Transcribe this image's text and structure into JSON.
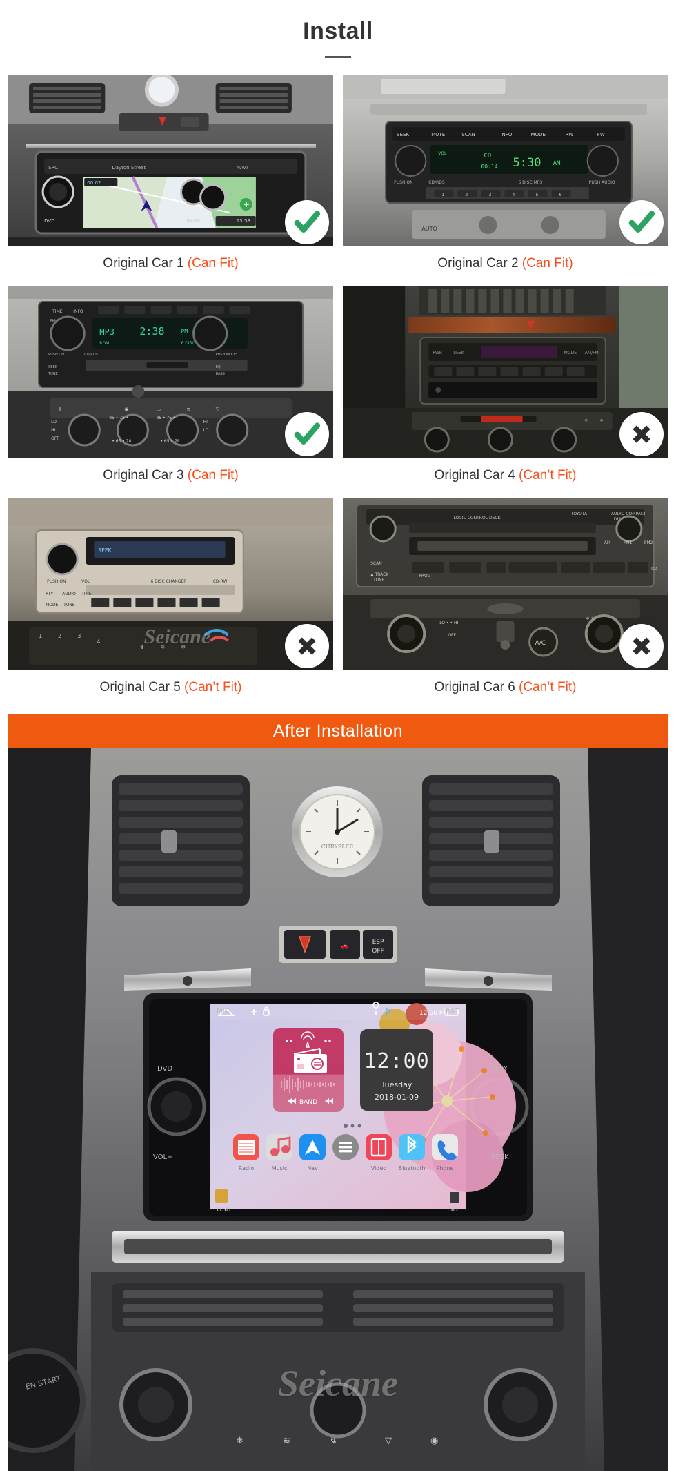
{
  "header": {
    "title": "Install"
  },
  "compat": {
    "cards": [
      {
        "label": "Original Car 1",
        "fit_text": "(Can Fit)",
        "status": "fit",
        "badge": "check-icon"
      },
      {
        "label": "Original Car 2",
        "fit_text": "(Can Fit)",
        "status": "fit",
        "badge": "check-icon"
      },
      {
        "label": "Original Car 3",
        "fit_text": "(Can Fit)",
        "status": "fit",
        "badge": "check-icon"
      },
      {
        "label": "Original Car 4",
        "fit_text": "(Can’t Fit)",
        "status": "nofit",
        "badge": "cross-icon"
      },
      {
        "label": "Original Car 5",
        "fit_text": "(Can’t Fit)",
        "status": "nofit",
        "badge": "cross-icon"
      },
      {
        "label": "Original Car 6",
        "fit_text": "(Can’t Fit)",
        "status": "nofit",
        "badge": "cross-icon"
      }
    ]
  },
  "after": {
    "banner_title": "After  Installation",
    "watermark_small": "Seicane",
    "watermark_big": "Seicane",
    "headunit": {
      "status_bar": {
        "time": "12:00 PM",
        "icons": [
          "home-icon",
          "usb-icon",
          "lock-icon",
          "location-icon",
          "bluetooth-icon",
          "wifi-icon",
          "signal-icon",
          "battery-icon"
        ]
      },
      "radio_widget": {
        "band_label": "BAND",
        "prev_icon": "rewind-icon",
        "next_icon": "fast-forward-icon",
        "radio_icon": "radio-icon"
      },
      "clock_widget": {
        "time": "12:00",
        "weekday": "Tuesday",
        "date": "2018-01-09"
      },
      "dock": [
        {
          "label": "Radio",
          "icon": "radio-app-icon",
          "color": "#F0544A"
        },
        {
          "label": "Music",
          "icon": "music-app-icon",
          "color": "#D9D9D9"
        },
        {
          "label": "Nav",
          "icon": "navigation-app-icon",
          "color": "#1E90F0"
        },
        {
          "label": "Apps",
          "icon": "app-drawer-icon",
          "color": "#8A8A8A"
        },
        {
          "label": "Video",
          "icon": "video-app-icon",
          "color": "#F0465A"
        },
        {
          "label": "Bluetooth",
          "icon": "bluetooth-app-icon",
          "color": "#4FC3F7"
        },
        {
          "label": "Phone",
          "icon": "phone-app-icon",
          "color": "#E8E8E8"
        }
      ]
    },
    "panel_labels": {
      "mic": "MIC",
      "rst": "RST",
      "dvd": "DVD",
      "play": "PLAY",
      "vol_plus": "VOL+",
      "seek": "SEEK",
      "usb": "USB",
      "sd": "SD",
      "esp_off": "ESP\nOFF"
    }
  },
  "colors": {
    "accent_orange": "#F05A10",
    "caption_orange": "#F4511E",
    "check_green": "#2BA463",
    "title_gray": "#333333"
  }
}
